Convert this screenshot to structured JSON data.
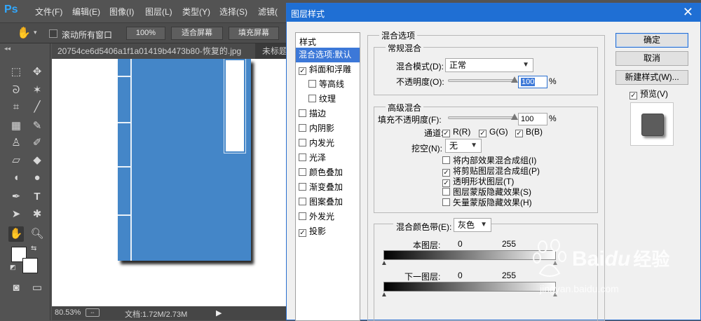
{
  "app": {
    "logo": "Ps",
    "menu": [
      "文件(F)",
      "编辑(E)",
      "图像(I)",
      "图层(L)",
      "类型(Y)",
      "选择(S)",
      "滤镜("
    ]
  },
  "options_bar": {
    "scroll_all_label": "滚动所有窗口",
    "zoom_100": "100%",
    "fit_screen": "适合屏幕",
    "fill_screen": "填充屏幕"
  },
  "tabs": {
    "collapse": "◂◂",
    "doc1": "20754ce6d5406a1f1a01419b4473b80-恢复的.jpg",
    "doc2": "未标题"
  },
  "status": {
    "zoom": "80.53%",
    "doc_info": "文档:1.72M/2.73M"
  },
  "dialog": {
    "title": "图层样式",
    "close": "✕",
    "style_list_header": "样式",
    "styles": [
      {
        "label": "混合选项:默认",
        "checkbox": false,
        "checked": false,
        "indent": false,
        "selected": true
      },
      {
        "label": "斜面和浮雕",
        "checkbox": true,
        "checked": true,
        "indent": false,
        "selected": false
      },
      {
        "label": "等高线",
        "checkbox": true,
        "checked": false,
        "indent": true,
        "selected": false
      },
      {
        "label": "纹理",
        "checkbox": true,
        "checked": false,
        "indent": true,
        "selected": false
      },
      {
        "label": "描边",
        "checkbox": true,
        "checked": false,
        "indent": false,
        "selected": false
      },
      {
        "label": "内阴影",
        "checkbox": true,
        "checked": false,
        "indent": false,
        "selected": false
      },
      {
        "label": "内发光",
        "checkbox": true,
        "checked": false,
        "indent": false,
        "selected": false
      },
      {
        "label": "光泽",
        "checkbox": true,
        "checked": false,
        "indent": false,
        "selected": false
      },
      {
        "label": "颜色叠加",
        "checkbox": true,
        "checked": false,
        "indent": false,
        "selected": false
      },
      {
        "label": "渐变叠加",
        "checkbox": true,
        "checked": false,
        "indent": false,
        "selected": false
      },
      {
        "label": "图案叠加",
        "checkbox": true,
        "checked": false,
        "indent": false,
        "selected": false
      },
      {
        "label": "外发光",
        "checkbox": true,
        "checked": false,
        "indent": false,
        "selected": false
      },
      {
        "label": "投影",
        "checkbox": true,
        "checked": true,
        "indent": false,
        "selected": false
      }
    ],
    "blend_options": {
      "group_title": "混合选项",
      "general": {
        "title": "常规混合",
        "blend_mode_label": "混合模式(D):",
        "blend_mode_value": "正常",
        "opacity_label": "不透明度(O):",
        "opacity_value": "100",
        "opacity_level": 1.0,
        "percent": "%"
      },
      "advanced": {
        "title": "高级混合",
        "fill_opacity_label": "填充不透明度(F):",
        "fill_opacity_value": "100",
        "fill_level": 1.0,
        "percent": "%",
        "channels_label": "通道:",
        "channel_r": "R(R)",
        "channel_g": "G(G)",
        "channel_b": "B(B)",
        "knockout_label": "挖空(N):",
        "knockout_value": "无",
        "options": [
          {
            "label": "将内部效果混合成组(I)",
            "checked": false
          },
          {
            "label": "将剪贴图层混合成组(P)",
            "checked": true
          },
          {
            "label": "透明形状图层(T)",
            "checked": true
          },
          {
            "label": "图层蒙版隐藏效果(S)",
            "checked": false
          },
          {
            "label": "矢量蒙版隐藏效果(H)",
            "checked": false
          }
        ]
      },
      "blend_if": {
        "label": "混合颜色带(E):",
        "value": "灰色",
        "this_layer_label": "本图层:",
        "this_low": "0",
        "this_high": "255",
        "underlying_label": "下一图层:",
        "under_low": "0",
        "under_high": "255"
      }
    },
    "buttons": {
      "ok": "确定",
      "cancel": "取消",
      "new_style": "新建样式(W)...",
      "preview_label": "预览(V)"
    }
  },
  "watermark": {
    "brand_a": "Bai",
    "brand_b": "du",
    "brand_cn": "经验",
    "url": "jingyan.baidu.com"
  }
}
